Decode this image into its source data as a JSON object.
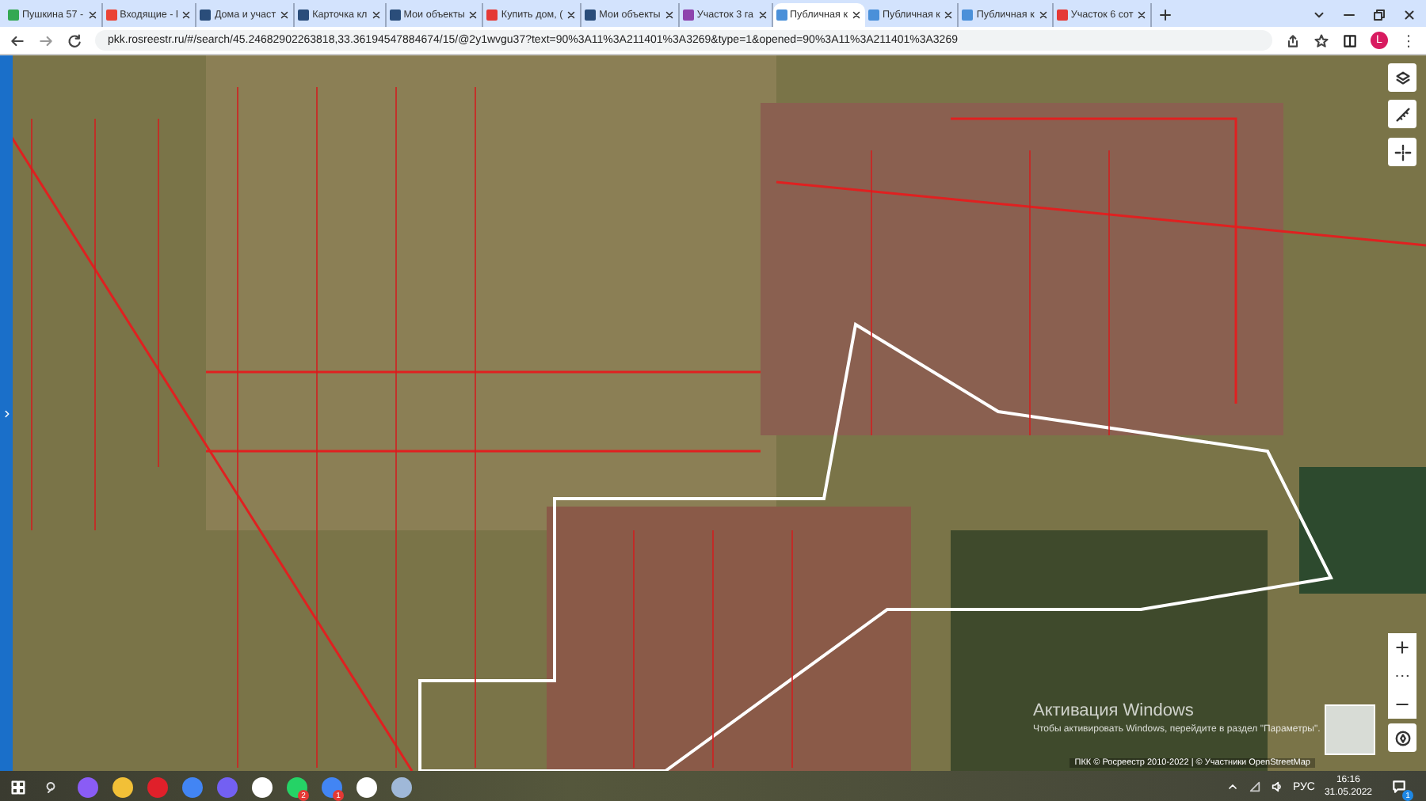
{
  "tabs": [
    {
      "title": "Пушкина 57 -",
      "selected": false
    },
    {
      "title": "Входящие - l",
      "selected": false
    },
    {
      "title": "Дома и участ",
      "selected": false
    },
    {
      "title": "Карточка кл",
      "selected": false
    },
    {
      "title": "Мои объекты",
      "selected": false
    },
    {
      "title": "Купить дом, (",
      "selected": false
    },
    {
      "title": "Мои объекты",
      "selected": false
    },
    {
      "title": "Участок 3 га",
      "selected": false
    },
    {
      "title": "Публичная к",
      "selected": true
    },
    {
      "title": "Публичная к",
      "selected": false
    },
    {
      "title": "Публичная к",
      "selected": false
    },
    {
      "title": "Участок 6 сот",
      "selected": false
    }
  ],
  "address": "pkk.rosreestr.ru/#/search/45.24682902263818,33.36194547884674/15/@2y1wvgu37?text=90%3A11%3A211401%3A3269&type=1&opened=90%3A11%3A211401%3A3269",
  "profile": "L",
  "map": {
    "activation_title": "Активация Windows",
    "activation_text": "Чтобы активировать Windows, перейдите в раздел \"Параметры\".",
    "attribution": "ПКК © Росреестр 2010-2022 | © Участники OpenStreetMap"
  },
  "taskbar": {
    "apps": [
      {
        "kind": "alice"
      },
      {
        "kind": "folder"
      },
      {
        "kind": "opera"
      },
      {
        "kind": "chrome"
      },
      {
        "kind": "viber"
      },
      {
        "kind": "yandex"
      },
      {
        "kind": "whatsapp",
        "badge": "2"
      },
      {
        "kind": "chrome",
        "badge": "1"
      },
      {
        "kind": "yandex"
      },
      {
        "kind": "paint"
      }
    ],
    "language": "РУС",
    "time": "16:16",
    "date": "31.05.2022",
    "notifications": "1"
  }
}
